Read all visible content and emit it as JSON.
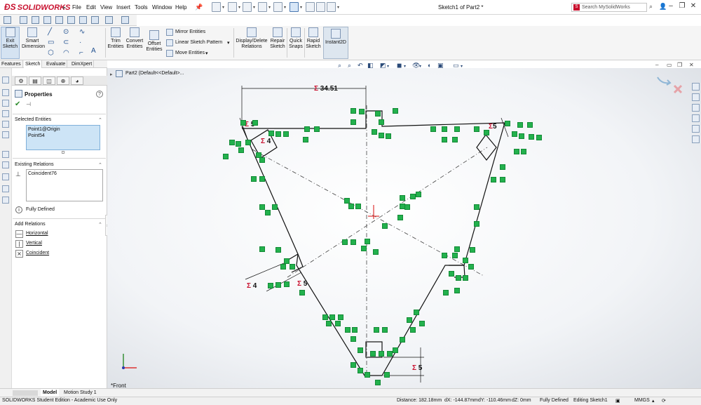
{
  "app": {
    "logo": "SOLIDWORKS",
    "menu": [
      "File",
      "Edit",
      "View",
      "Insert",
      "Tools",
      "Window",
      "Help"
    ],
    "doc_title": "Sketch1 of Part2 *",
    "search_placeholder": "Search MySolidWorks"
  },
  "command_manager": {
    "exit_sketch": "Exit Sketch",
    "smart_dimension": "Smart Dimension",
    "trim_entities": "Trim Entities",
    "convert_entities": "Convert Entities",
    "offset_entities": "Offset Entities",
    "mirror_entities": "Mirror Entities",
    "linear_sketch_pattern": "Linear Sketch Pattern",
    "move_entities": "Move Entities",
    "display_delete_relations": "Display/Delete Relations",
    "repair_sketch": "Repair Sketch",
    "quick_snaps": "Quick Snaps",
    "rapid_sketch": "Rapid Sketch",
    "instant2d": "Instant2D"
  },
  "tabs": [
    "Features",
    "Sketch",
    "Evaluate",
    "DimXpert"
  ],
  "property_manager": {
    "title": "Properties",
    "selected_entities_label": "Selected Entities",
    "selected_entities": [
      "Point1@Origin",
      "Point54"
    ],
    "existing_relations_label": "Existing Relations",
    "existing_relations": [
      "Coincident76"
    ],
    "status": "Fully Defined",
    "add_relations_label": "Add Relations",
    "add_relations": [
      "Horizontal",
      "Vertical",
      "Coincident"
    ]
  },
  "tree": {
    "item": "Part2  (Default<<Default>..."
  },
  "dimensions": {
    "top": "34.51",
    "left_top": "5",
    "left_mid": "4",
    "left_bot_a": "4",
    "left_bot_b": "5",
    "right_top": "5",
    "bottom": "5"
  },
  "view_label": "*Front",
  "bottom_tabs": [
    "Model",
    "Motion Study 1"
  ],
  "status": {
    "edition": "SOLIDWORKS Student Edition - Academic Use Only",
    "distance": "Distance: 182.18mm",
    "dx": "dX: -144.87mm",
    "dy": "dY: -110.46mm",
    "dz": "dZ: 0mm",
    "defined": "Fully Defined",
    "editing": "Editing Sketch1",
    "units": "MMGS"
  },
  "colors": {
    "accent": "#c8102e",
    "relation_green": "#23b14d",
    "sketch_line": "#111111"
  }
}
